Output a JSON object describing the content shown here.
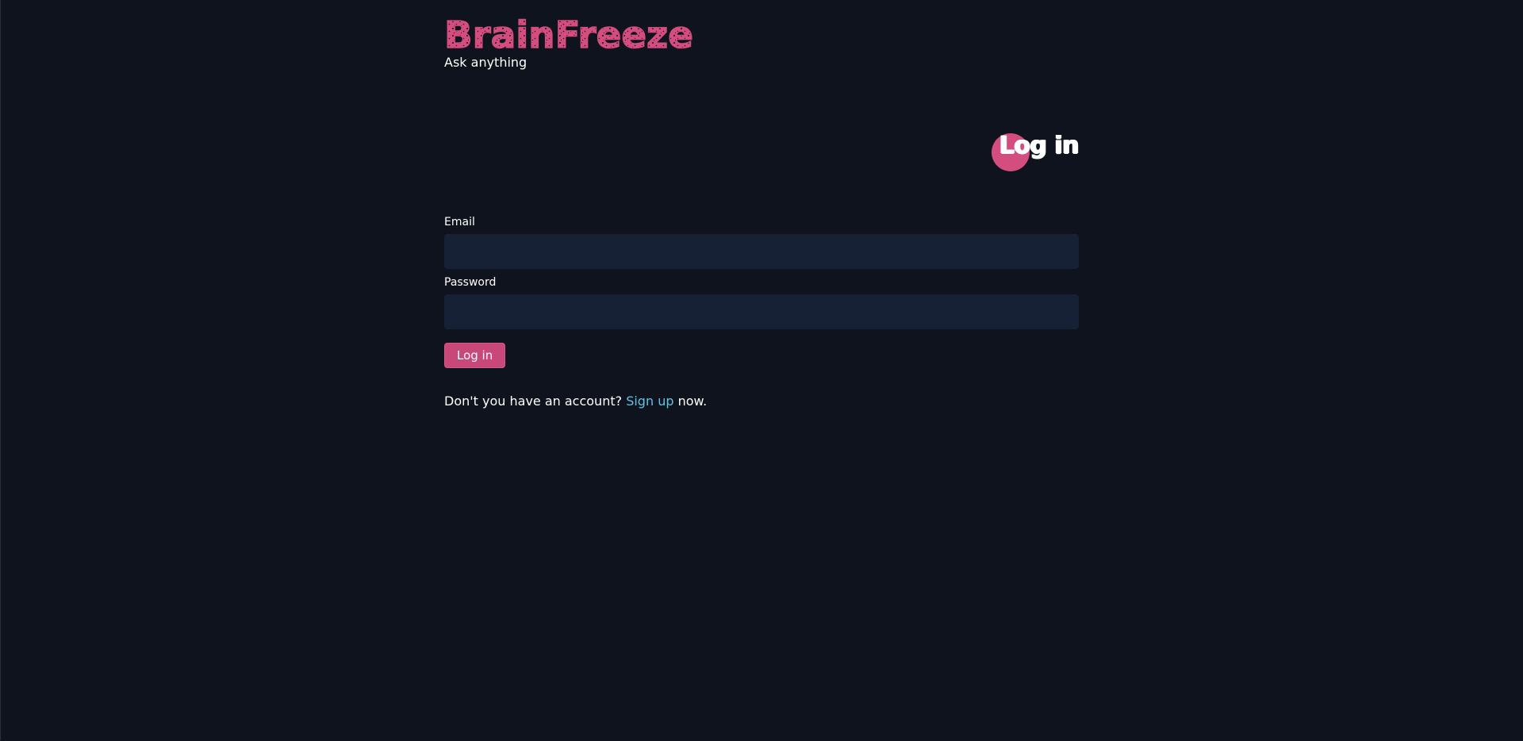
{
  "brand": {
    "logo_text": "BrainFreeze",
    "tagline": "Ask anything",
    "accent_color": "#d44d7f"
  },
  "page": {
    "heading": "Log in"
  },
  "form": {
    "email_label": "Email",
    "email_value": "",
    "password_label": "Password",
    "password_value": "",
    "submit_label": "Log in"
  },
  "signup": {
    "prefix": "Don't you have an account?",
    "link_text": "Sign up",
    "suffix": "now.",
    "link_color": "#5ec3e6"
  }
}
